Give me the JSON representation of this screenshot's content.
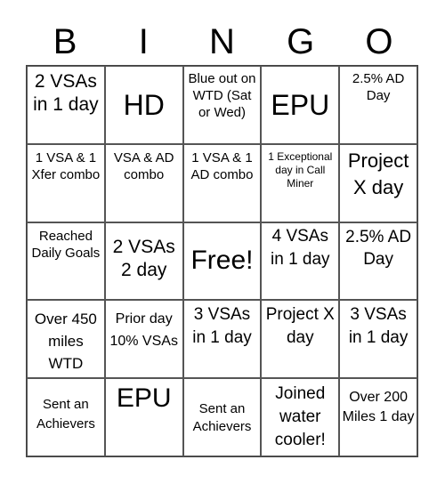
{
  "header": {
    "letters": [
      "B",
      "I",
      "N",
      "G",
      "O"
    ]
  },
  "board": {
    "rows": [
      [
        "2 VSAs in 1 day",
        "HD",
        "Blue out on WTD (Sat or Wed)",
        "EPU",
        "2.5% AD Day"
      ],
      [
        "1 VSA & 1 Xfer combo",
        "VSA & AD combo",
        "1 VSA & 1 AD combo",
        "1 Exceptional day in Call Miner",
        "Project X day"
      ],
      [
        "Reached Daily Goals",
        "2 VSAs 2 day",
        "Free!",
        "4 VSAs in 1 day",
        "2.5% AD Day"
      ],
      [
        "Over 450 miles WTD",
        "Prior day 10% VSAs",
        "3 VSAs in 1 day",
        "Project X day",
        "3 VSAs in 1 day"
      ],
      [
        "Sent an Achievers",
        "EPU",
        "Sent an Achievers",
        "Joined water cooler!",
        "Over 200 Miles 1 day"
      ]
    ]
  }
}
